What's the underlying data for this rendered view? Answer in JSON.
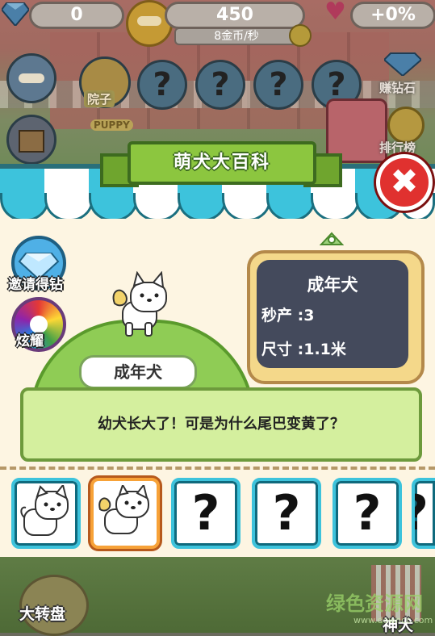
{
  "hud": {
    "gems": "0",
    "coins": "450",
    "coin_rate": "8金币/秒",
    "bonus": "+0%"
  },
  "background": {
    "yard_label": "院子",
    "earn_gems_label": "赚钻石",
    "leaderboard_label": "排行榜",
    "puppy_sign": "PUPPY",
    "bottom_left_label": "大转盘",
    "bottom_right_label": "神犬",
    "locked_slot": "?"
  },
  "modal": {
    "title": "萌犬大百科",
    "invite_label": "邀请得钻",
    "flash_label": "炫耀",
    "dog_name": "成年犬",
    "info": {
      "title": "成年犬",
      "rate_label": "秒产 :",
      "rate_value": "3",
      "size_label": "尺寸 :",
      "size_value": "1.1米"
    },
    "description": "幼犬长大了！可是为什么尾巴变黄了？",
    "cards": [
      {
        "kind": "dog",
        "variant": "puppy",
        "selected": false
      },
      {
        "kind": "dog",
        "variant": "adult",
        "selected": true
      },
      {
        "kind": "locked",
        "label": "?"
      },
      {
        "kind": "locked",
        "label": "?"
      },
      {
        "kind": "locked",
        "label": "?"
      },
      {
        "kind": "locked",
        "label": "?"
      }
    ]
  },
  "watermark": {
    "text": "绿色资源网",
    "url": "www.downcc.com"
  },
  "colors": {
    "awning_teal": "#3dc3dc",
    "awning_white": "#ffffff",
    "ribbon_green": "#8cc63f",
    "close_red": "#e0312f",
    "info_panel": "#444a5c",
    "card_selected": "#f7a238"
  }
}
